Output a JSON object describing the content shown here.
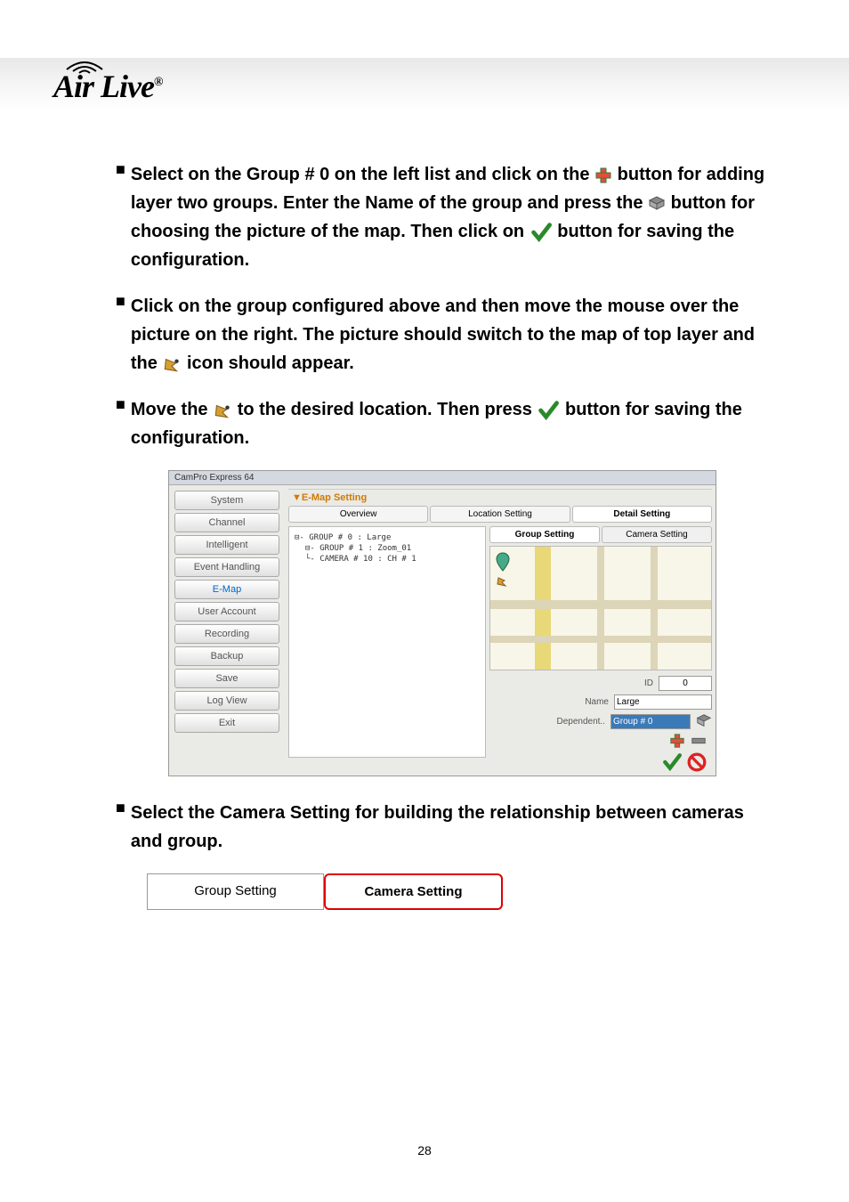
{
  "logo": {
    "brand": "Air Live",
    "registered": "®"
  },
  "bullets": {
    "b1_part1": "Select on the Group # 0 on the left list and click on the ",
    "b1_part2": " button for adding layer two groups. Enter the Name of the group and press the ",
    "b1_part3": " button for choosing the picture of the map. Then click on ",
    "b1_part4": " button for saving the configuration.",
    "b2_part1": "Click on the group configured above and then move the mouse over the picture on the right. The picture should switch to the map of top layer and the ",
    "b2_part2": " icon should appear.",
    "b3_part1": "Move the ",
    "b3_part2": " to the desired location. Then press ",
    "b3_part3": " button for saving the configuration.",
    "b4": "Select the Camera Setting for building the relationship between cameras and group."
  },
  "screenshot": {
    "title": "CamPro Express 64",
    "sidebar": [
      "System",
      "Channel",
      "Intelligent",
      "Event Handling",
      "E-Map",
      "User Account",
      "Recording",
      "Backup",
      "Save",
      "Log View",
      "Exit"
    ],
    "section_title": "E-Map Setting",
    "main_tabs": [
      "Overview",
      "Location Setting",
      "Detail Setting"
    ],
    "tree": [
      "⊟- GROUP # 0 : Large",
      "  ⊟- GROUP # 1 : Zoom_01",
      "    └- CAMERA # 10 : CH # 1"
    ],
    "sub_tabs": [
      "Group Setting",
      "Camera Setting"
    ],
    "fields": {
      "id_label": "ID",
      "id_value": "0",
      "name_label": "Name",
      "name_value": "Large",
      "dependent_label": "Dependent..",
      "dependent_value": "Group # 0"
    }
  },
  "bottom_tabs": {
    "group": "Group Setting",
    "camera": "Camera Setting"
  },
  "page_number": "28"
}
